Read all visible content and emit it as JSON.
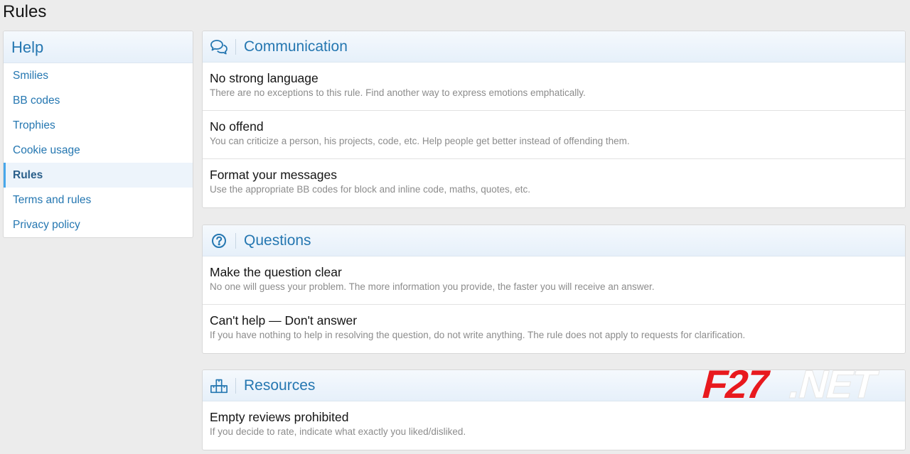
{
  "page": {
    "title": "Rules"
  },
  "sidebar": {
    "header": "Help",
    "items": [
      {
        "label": "Smilies"
      },
      {
        "label": "BB codes"
      },
      {
        "label": "Trophies"
      },
      {
        "label": "Cookie usage"
      },
      {
        "label": "Rules",
        "active": true
      },
      {
        "label": "Terms and rules"
      },
      {
        "label": "Privacy policy"
      }
    ]
  },
  "sections": [
    {
      "icon": "comments-icon",
      "title": "Communication",
      "rules": [
        {
          "title": "No strong language",
          "desc": "There are no exceptions to this rule. Find another way to express emotions emphatically."
        },
        {
          "title": "No offend",
          "desc": "You can criticize a person, his projects, code, etc. Help people get better instead of offending them."
        },
        {
          "title": "Format your messages",
          "desc": "Use the appropriate BB codes for block and inline code, maths, quotes, etc."
        }
      ]
    },
    {
      "icon": "question-circle-icon",
      "title": "Questions",
      "rules": [
        {
          "title": "Make the question clear",
          "desc": "No one will guess your problem. The more information you provide, the faster you will receive an answer."
        },
        {
          "title": "Can't help — Don't answer",
          "desc": "If you have nothing to help in resolving the question, do not write anything. The rule does not apply to requests for clarification."
        }
      ]
    },
    {
      "icon": "boxes-icon",
      "title": "Resources",
      "rules": [
        {
          "title": "Empty reviews prohibited",
          "desc": "If you decide to rate, indicate what exactly you liked/disliked."
        }
      ]
    }
  ],
  "watermark": {
    "text": "F27.NET",
    "colors": {
      "f27": "#e8191e",
      "net": "#ffffff"
    }
  },
  "colors": {
    "link": "#2577b1",
    "accent": "#47a7eb"
  }
}
